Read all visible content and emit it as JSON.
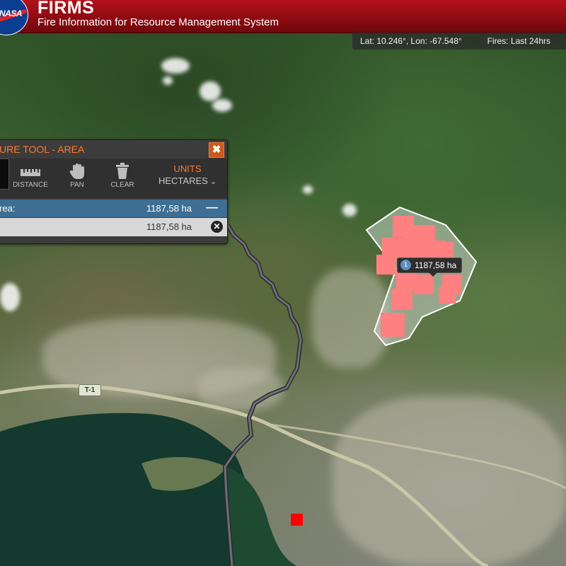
{
  "header": {
    "logo_text": "NASA",
    "title": "FIRMS",
    "subtitle": "Fire Information for Resource Management System"
  },
  "status_bar": {
    "coordinates": "Lat: 10.246°, Lon: -67.548°",
    "fires_period": "Fires: Last 24hrs"
  },
  "measure_tool": {
    "title": "URE TOOL - AREA",
    "close_label": "✖",
    "tools": [
      {
        "label": "DISTANCE",
        "icon": "ruler-icon"
      },
      {
        "label": "PAN",
        "icon": "hand-icon"
      },
      {
        "label": "CLEAR",
        "icon": "trash-icon"
      }
    ],
    "units_label": "UNITS",
    "units_value": "HECTARES",
    "results": [
      {
        "label": "rea:",
        "value": "1187,58 ha",
        "action": "—"
      },
      {
        "label": "",
        "value": "1187,58 ha",
        "action": "✕"
      }
    ]
  },
  "map": {
    "polygon_label_index": "1",
    "polygon_label_value": "1187,58 ha",
    "road_shield": "T-1",
    "colors": {
      "fire_pixels": "#ff8080",
      "hotspot": "#ff0000",
      "polygon_stroke": "#ffffff",
      "header": "#a00d14",
      "accent": "#ff7a2e"
    }
  }
}
